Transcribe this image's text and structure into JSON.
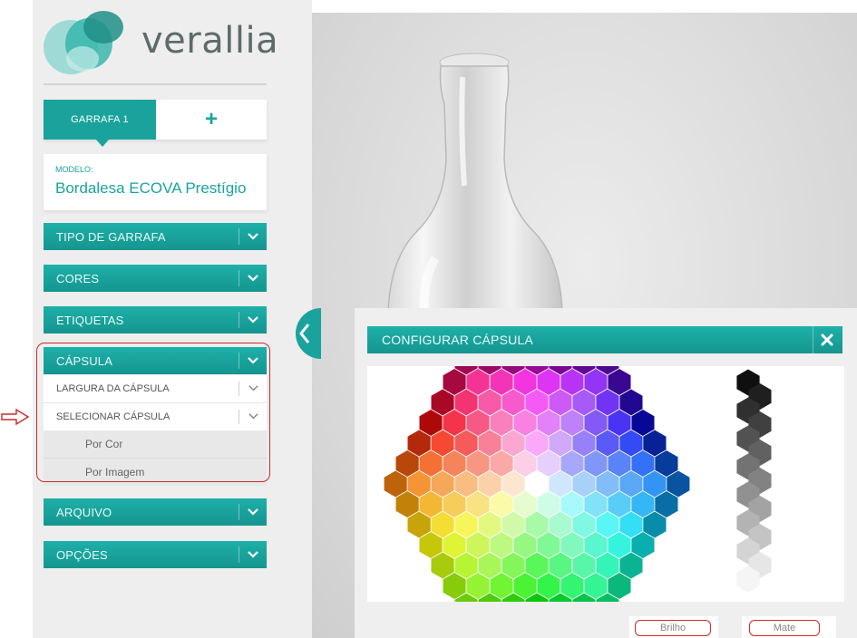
{
  "brand": {
    "name": "verallia"
  },
  "bottle_tabs": {
    "active": "GARRAFA 1",
    "add": "+"
  },
  "model": {
    "label": "MODELO:",
    "name": "Bordalesa ECOVA Prestígio"
  },
  "sidebar": {
    "sections": [
      {
        "label": "TIPO DE GARRAFA",
        "icon": "chevron-down-icon"
      },
      {
        "label": "CORES",
        "icon": "chevron-down-icon"
      },
      {
        "label": "ETIQUETAS",
        "icon": "chevron-down-icon"
      },
      {
        "label": "CÁPSULA",
        "icon": "chevron-down-icon"
      },
      {
        "label": "ARQUIVO",
        "icon": "chevron-down-icon"
      },
      {
        "label": "OPÇÕES",
        "icon": "chevron-down-icon"
      }
    ],
    "capsula_items": [
      {
        "label": "LARGURA DA CÁPSULA"
      },
      {
        "label": "SELECIONAR CÁPSULA"
      }
    ],
    "capsula_options": [
      {
        "label": "Por Cor"
      },
      {
        "label": "Por Imagem"
      }
    ]
  },
  "dialog": {
    "title": "CONFIGURAR CÁPSULA",
    "close_icon": "close-icon",
    "finish_buttons": [
      "Brilho",
      "Mate"
    ]
  },
  "colors": {
    "accent": "#1aa39d",
    "highlight": "#cc2a2a"
  }
}
